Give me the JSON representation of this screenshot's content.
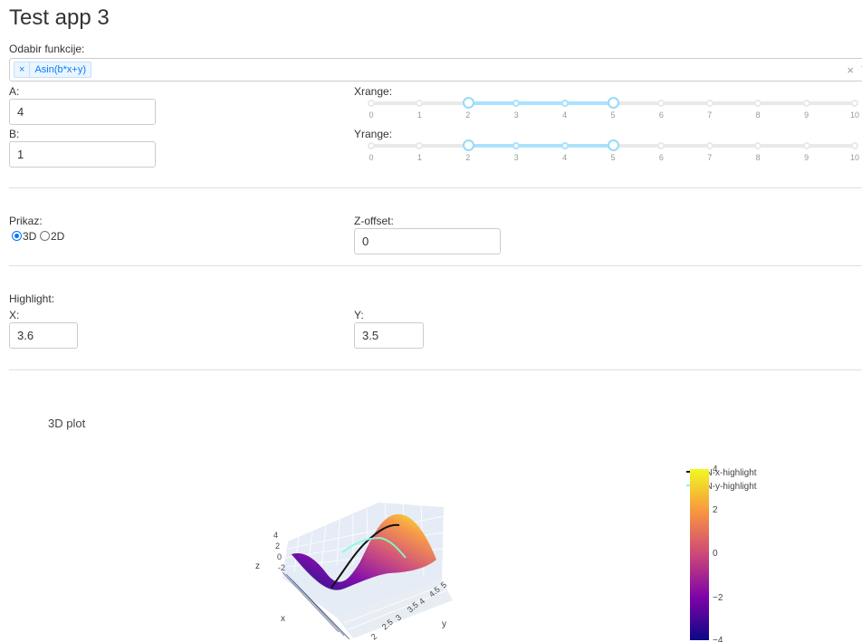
{
  "app": {
    "title": "Test app 3"
  },
  "function_select": {
    "label": "Odabir funkcije:",
    "selected_tag": "Asin(b*x+y)",
    "remove_glyph": "×",
    "clear_glyph": "×"
  },
  "params": {
    "a_label": "A:",
    "a_value": "4",
    "b_label": "B:",
    "b_value": "1"
  },
  "xrange": {
    "label": "Xrange:",
    "min": 0,
    "max": 10,
    "low": 2,
    "high": 5,
    "ticks": [
      "0",
      "1",
      "2",
      "3",
      "4",
      "5",
      "6",
      "7",
      "8",
      "9",
      "10"
    ]
  },
  "yrange": {
    "label": "Yrange:",
    "min": 0,
    "max": 10,
    "low": 2,
    "high": 5,
    "ticks": [
      "0",
      "1",
      "2",
      "3",
      "4",
      "5",
      "6",
      "7",
      "8",
      "9",
      "10"
    ]
  },
  "display": {
    "label": "Prikaz:",
    "options": [
      "3D",
      "2D"
    ],
    "selected": "3D"
  },
  "zoffset": {
    "label": "Z-offset:",
    "value": "0"
  },
  "highlight": {
    "label": "Highlight:",
    "x_label": "X:",
    "x_value": "3.6",
    "y_label": "Y:",
    "y_value": "3.5"
  },
  "plot": {
    "title": "3D plot",
    "colors": {
      "dark": "#0d0887",
      "purple": "#7e03a8",
      "pink": "#cc4778",
      "orange": "#f89540",
      "yellow": "#f0f921",
      "x_highlight": "#111111",
      "y_highlight": "#7fffd4"
    },
    "chart_data": {
      "type": "surface",
      "title": "3D plot",
      "function": "Asin(b*x+y)",
      "params": {
        "A": 4,
        "B": 1
      },
      "x_range": [
        2,
        5
      ],
      "y_range": [
        2,
        5
      ],
      "z_range": [
        -4,
        4
      ],
      "axis_labels": {
        "x": "x",
        "y": "y",
        "z": "z"
      },
      "y_ticks": [
        "2",
        "2.5",
        "3",
        "3.5",
        "4",
        "4.5",
        "5"
      ],
      "z_ticks": [
        "4",
        "2",
        "0",
        "-2"
      ],
      "series": [
        {
          "name": "SIN-x-highlight",
          "color": "#111111",
          "fixed_x": 3.6
        },
        {
          "name": "SIN-y-highlight",
          "color": "#7fffd4",
          "fixed_y": 3.5
        }
      ],
      "colorbar": {
        "min": -4,
        "max": 4,
        "ticks": [
          "4",
          "2",
          "0",
          "−2",
          "−4"
        ]
      }
    }
  }
}
